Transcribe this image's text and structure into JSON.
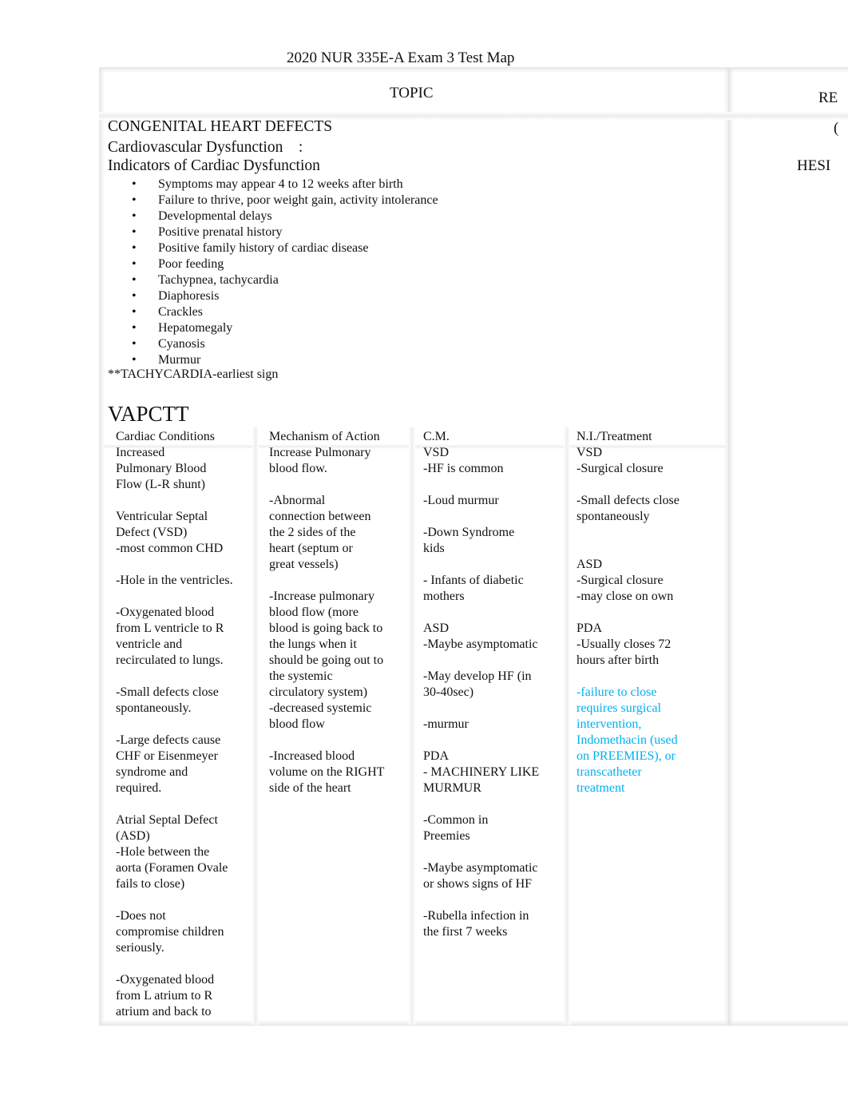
{
  "title": "2020 NUR 335E-A Exam 3 Test Map",
  "header": {
    "topic": "TOPIC",
    "right_header_partial": "RE",
    "right_paren_partial": "(",
    "right_hesi_partial": "HESI"
  },
  "section": {
    "heading": "CONGENITAL HEART DEFECTS",
    "subheading": "Cardiovascular Dysfunction    :",
    "indicators_title": "Indicators of Cardiac Dysfunction",
    "indicators": [
      "Symptoms may appear 4 to 12 weeks after birth",
      "Failure to thrive, poor weight gain, activity intolerance",
      "Developmental delays",
      "Positive prenatal history",
      "Positive family history of cardiac disease",
      "Poor feeding",
      "Tachypnea, tachycardia",
      "Diaphoresis",
      "Crackles",
      "Hepatomegaly",
      "Cyanosis",
      "Murmur"
    ],
    "note": "**TACHYCARDIA-earliest sign"
  },
  "vapctt": {
    "title": "VAPCTT",
    "accent_color": "#00b0f0",
    "columns": [
      {
        "lines": [
          "Cardiac Conditions",
          "Increased",
          "Pulmonary Blood",
          "Flow (L-R shunt)",
          "",
          "Ventricular Septal",
          "Defect (VSD)",
          "-most common CHD",
          "",
          "-Hole in the ventricles.",
          "",
          "-Oxygenated blood",
          "from L ventricle to R",
          "ventricle and",
          "recirculated to lungs.",
          "",
          "-Small defects close",
          "spontaneously.",
          "",
          "-Large defects cause",
          "CHF or Eisenmeyer",
          "syndrome and",
          "required.",
          "",
          "Atrial Septal Defect",
          "(ASD)",
          "-Hole between the",
          "aorta (Foramen Ovale",
          "fails to close)",
          "",
          "-Does not",
          "compromise children",
          "seriously.",
          "",
          "-Oxygenated blood",
          "from L atrium to R",
          "atrium and back to"
        ]
      },
      {
        "lines": [
          "Mechanism of Action",
          "Increase Pulmonary",
          "blood flow.",
          "",
          "-Abnormal",
          "connection between",
          "the 2 sides of the",
          "heart (septum or",
          "great vessels)",
          "",
          "-Increase pulmonary",
          "blood flow (more",
          "blood is going back to",
          "the lungs when it",
          "should be going out to",
          "the systemic",
          "circulatory system)",
          "-decreased systemic",
          "blood flow",
          "",
          "-Increased blood",
          "volume on the RIGHT",
          "side of the heart"
        ]
      },
      {
        "lines": [
          "C.M.",
          "VSD",
          "-HF is common",
          "",
          "-Loud murmur",
          "",
          "-Down Syndrome",
          "kids",
          "",
          "- Infants of diabetic",
          "mothers",
          "",
          "ASD",
          "-Maybe asymptomatic",
          "",
          "-May develop HF (in",
          "30-40sec)",
          "",
          "-murmur",
          "",
          "PDA",
          "- MACHINERY LIKE",
          "MURMUR",
          "",
          "-Common in",
          "Preemies",
          "",
          "-Maybe asymptomatic",
          "or shows signs of HF",
          "",
          "-Rubella infection in",
          "the first 7 weeks"
        ]
      },
      {
        "lines": [
          "N.I./Treatment",
          "VSD",
          "-Surgical closure",
          "",
          "-Small defects close",
          "spontaneously",
          "",
          "",
          "ASD",
          "-Surgical closure",
          "-may close on own",
          "",
          "PDA",
          "-Usually closes 72",
          "hours after birth",
          ""
        ],
        "highlighted_lines": [
          "-failure to close",
          "requires surgical",
          "intervention,",
          "Indomethacin (used",
          "on PREEMIES), or",
          "transcatheter",
          "treatment"
        ]
      }
    ]
  }
}
